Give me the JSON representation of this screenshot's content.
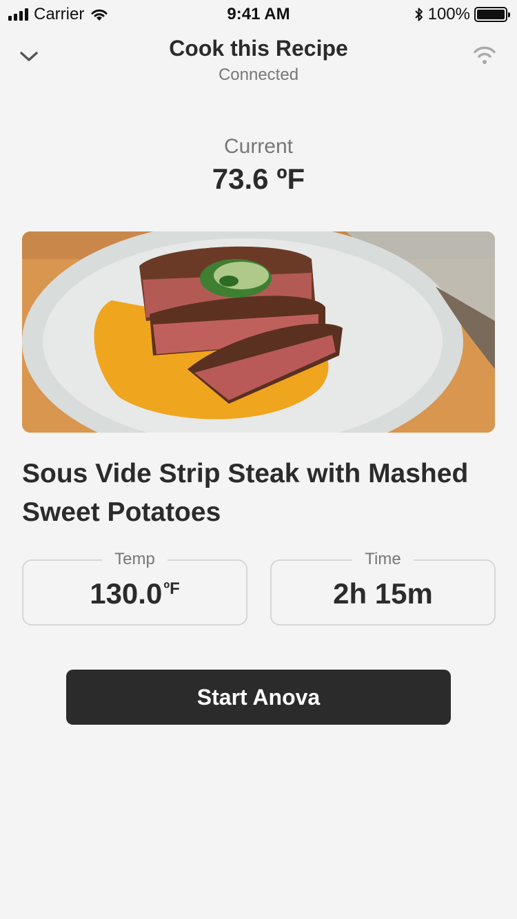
{
  "status_bar": {
    "carrier": "Carrier",
    "time": "9:41 AM",
    "battery_percent": "100%"
  },
  "nav": {
    "title": "Cook this Recipe",
    "subtitle": "Connected",
    "back_icon": "chevron-down-icon",
    "connection_icon": "wifi-icon"
  },
  "current": {
    "label": "Current",
    "value": "73.6 ºF"
  },
  "recipe": {
    "title": "Sous Vide Strip Steak with Mashed Sweet Potatoes"
  },
  "settings": {
    "temp_label": "Temp",
    "temp_value": "130.0",
    "temp_unit": "ºF",
    "time_label": "Time",
    "time_value": "2h 15m"
  },
  "action": {
    "start_label": "Start Anova"
  },
  "colors": {
    "background": "#f4f4f4",
    "text_primary": "#2b2b2b",
    "text_secondary": "#777777",
    "button_bg": "#2b2b2b",
    "box_border": "#d6d6d6"
  }
}
